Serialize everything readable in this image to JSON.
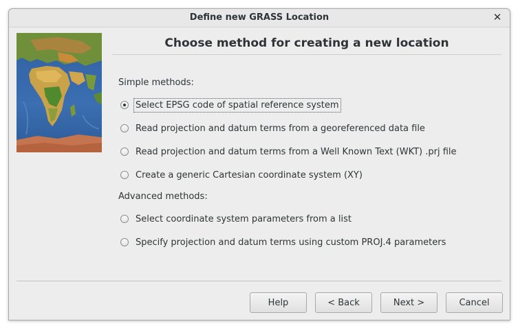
{
  "window": {
    "title": "Define new GRASS Location",
    "close_glyph": "✕"
  },
  "header": {
    "title": "Choose method for creating a new location"
  },
  "sections": {
    "simple_label": "Simple methods:",
    "advanced_label": "Advanced methods:"
  },
  "options": {
    "epsg": "Select EPSG code of spatial reference system",
    "georef_file": "Read projection and datum terms from a georeferenced data file",
    "wkt_file": "Read projection and datum terms from a Well Known Text (WKT) .prj file",
    "xy": "Create a generic Cartesian coordinate system (XY)",
    "param_list": "Select coordinate system parameters from a list",
    "proj4": "Specify projection and datum terms using custom PROJ.4 parameters"
  },
  "selected_option": "epsg",
  "buttons": {
    "help": "Help",
    "back": "< Back",
    "next": "Next >",
    "cancel": "Cancel"
  },
  "icons": {
    "close": "close-icon",
    "map": "world-map-image",
    "radio": "radio-icon"
  }
}
